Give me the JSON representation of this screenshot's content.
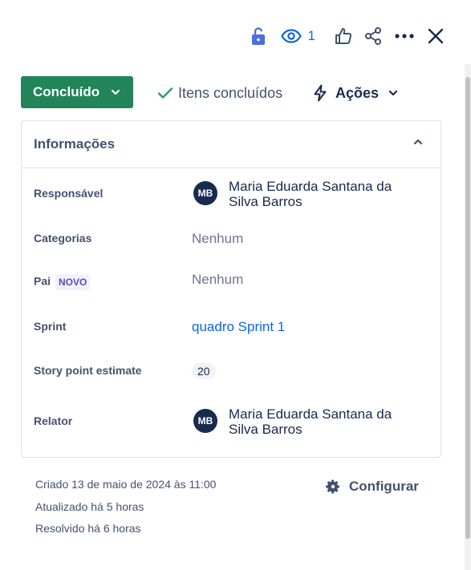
{
  "toolbar": {
    "lock_icon": "unlock-icon",
    "watchers_count": "1",
    "like_icon": "thumbs-up-icon",
    "share_icon": "share-icon",
    "more_icon": "more-icon",
    "close_icon": "close-icon"
  },
  "status": {
    "label": "Concluído"
  },
  "done_items": {
    "label": "Itens concluídos"
  },
  "actions": {
    "label": "Ações"
  },
  "details": {
    "title": "Informações",
    "assignee": {
      "label": "Responsável",
      "initials": "MB",
      "name": "Maria Eduarda Santana da Silva Barros"
    },
    "categories": {
      "label": "Categorias",
      "value": "Nenhum"
    },
    "parent": {
      "label": "Pai",
      "badge": "NOVO",
      "value": "Nenhum"
    },
    "sprint": {
      "label": "Sprint",
      "value": "quadro Sprint 1"
    },
    "story_points": {
      "label": "Story point estimate",
      "value": "20"
    },
    "reporter": {
      "label": "Relator",
      "initials": "MB",
      "name": "Maria Eduarda Santana da Silva Barros"
    }
  },
  "footer": {
    "created": "Criado 13 de maio de 2024 às 11:00",
    "updated": "Atualizado há 5 horas",
    "resolved": "Resolvido há 6 horas",
    "configure_label": "Configurar"
  },
  "colors": {
    "status_green": "#22845a",
    "link_blue": "#0c66e4",
    "avatar_navy": "#172b4d"
  }
}
